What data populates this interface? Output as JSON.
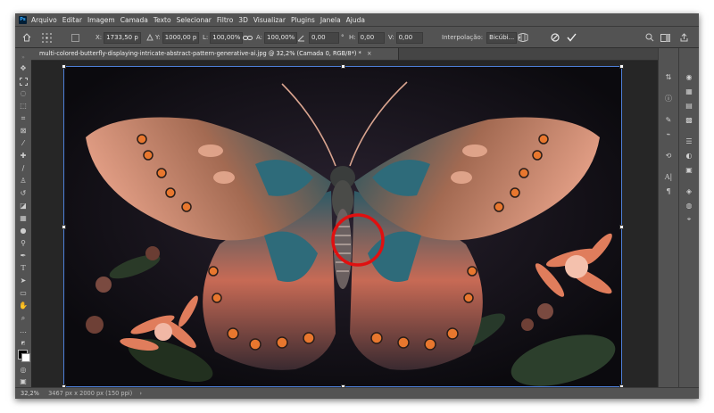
{
  "app": {
    "logo_text": "Ps"
  },
  "menu": [
    "Arquivo",
    "Editar",
    "Imagem",
    "Camada",
    "Texto",
    "Selecionar",
    "Filtro",
    "3D",
    "Visualizar",
    "Plugins",
    "Janela",
    "Ajuda"
  ],
  "options": {
    "x_label": "X:",
    "x_value": "1733,50 p",
    "y_label": "Y:",
    "y_value": "1000,00 p",
    "w_label": "L:",
    "w_value": "100,00%",
    "h_label": "A:",
    "h_value": "100,00%",
    "angle_value": "0,00",
    "hskew_label": "H:",
    "hskew_value": "0,00",
    "vskew_label": "V:",
    "vskew_value": "0,00",
    "interp_label": "Interpolação:",
    "interp_value": "Bicúbi..."
  },
  "document": {
    "tab_title": "multi-colored-butterfly-displaying-intricate-abstract-pattern-generative-ai.jpg @ 32,2% (Camada 0, RGB/8*) *",
    "close_glyph": "×"
  },
  "status": {
    "zoom": "32,2%",
    "dimensions": "3467 px x 2000 px (150 ppi)"
  },
  "colors": {
    "annotation_circle": "#e01010",
    "transform_box": "#4d7fd8"
  }
}
